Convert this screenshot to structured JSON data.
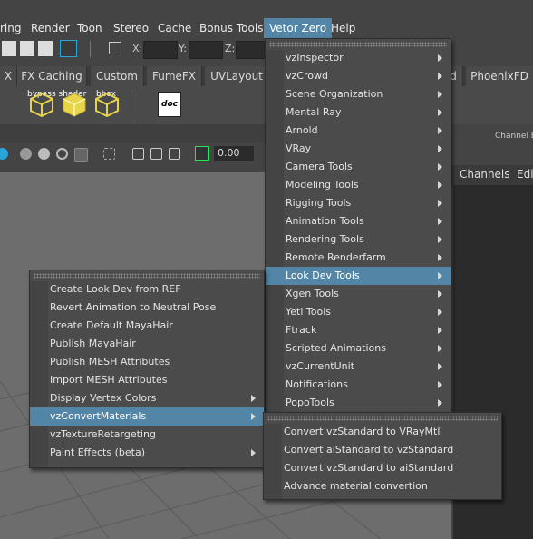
{
  "menubar": {
    "items": [
      "ring",
      "Render",
      "Toon",
      "Stereo",
      "Cache",
      "Bonus Tools",
      "Vetor Zero",
      "Help"
    ]
  },
  "statusline": {
    "x_label": "X:",
    "y_label": "Y:",
    "z_label": "Z:"
  },
  "shelf_tabs": [
    "X",
    "FX Caching",
    "Custom",
    "FumeFX",
    "UVLayout",
    "d",
    "PhoenixFD"
  ],
  "shelf": {
    "labels": [
      "bypass shader",
      "bbox"
    ],
    "doc_icon_label": "doc"
  },
  "toolbar": {
    "value": "0.00"
  },
  "right_panel": {
    "title": "Channel Bo",
    "tabs": [
      "Channels",
      "Edit"
    ]
  },
  "vetor_menu": {
    "items": [
      {
        "label": "vzInspector",
        "submenu": true
      },
      {
        "label": "vzCrowd",
        "submenu": true
      },
      {
        "label": "Scene Organization",
        "submenu": true
      },
      {
        "label": "Mental Ray",
        "submenu": true
      },
      {
        "label": "Arnold",
        "submenu": true
      },
      {
        "label": "VRay",
        "submenu": true
      },
      {
        "label": "Camera Tools",
        "submenu": true
      },
      {
        "label": "Modeling Tools",
        "submenu": true
      },
      {
        "label": "Rigging Tools",
        "submenu": true
      },
      {
        "label": "Animation Tools",
        "submenu": true
      },
      {
        "label": "Rendering Tools",
        "submenu": true
      },
      {
        "label": "Remote Renderfarm",
        "submenu": true
      },
      {
        "label": "Look Dev Tools",
        "submenu": true,
        "highlighted": true
      },
      {
        "label": "Xgen Tools",
        "submenu": true
      },
      {
        "label": "Yeti Tools",
        "submenu": true
      },
      {
        "label": "Ftrack",
        "submenu": true
      },
      {
        "label": "Scripted Animations",
        "submenu": true
      },
      {
        "label": "vzCurrentUnit",
        "submenu": true
      },
      {
        "label": "Notifications",
        "submenu": true
      },
      {
        "label": "PopoTools",
        "submenu": true
      }
    ]
  },
  "lookdev_menu": {
    "items": [
      {
        "label": "Create Look Dev from REF",
        "submenu": false
      },
      {
        "label": "Revert Animation to Neutral Pose",
        "submenu": false
      },
      {
        "label": "Create Default MayaHair",
        "submenu": false
      },
      {
        "label": "Publish MayaHair",
        "submenu": false
      },
      {
        "label": "Publish MESH Attributes",
        "submenu": false
      },
      {
        "label": "Import MESH Attributes",
        "submenu": false
      },
      {
        "label": "Display Vertex Colors",
        "submenu": true
      },
      {
        "label": "vzConvertMaterials",
        "submenu": true,
        "highlighted": true
      },
      {
        "label": "vzTextureRetargeting",
        "submenu": false
      },
      {
        "label": "Paint Effects (beta)",
        "submenu": true
      }
    ]
  },
  "convert_menu": {
    "items": [
      {
        "label": "Convert vzStandard to VRayMtl"
      },
      {
        "label": "Convert aiStandard to vzStandard"
      },
      {
        "label": "Convert vzStandard to aiStandard"
      },
      {
        "label": "Advance material convertion"
      }
    ]
  },
  "colors": {
    "highlight": "#5285a6",
    "menu_bg": "#4b4b4b",
    "viewport_bg": "#6d6d6d",
    "shelf_icon_yellow": "#e8d44a"
  }
}
